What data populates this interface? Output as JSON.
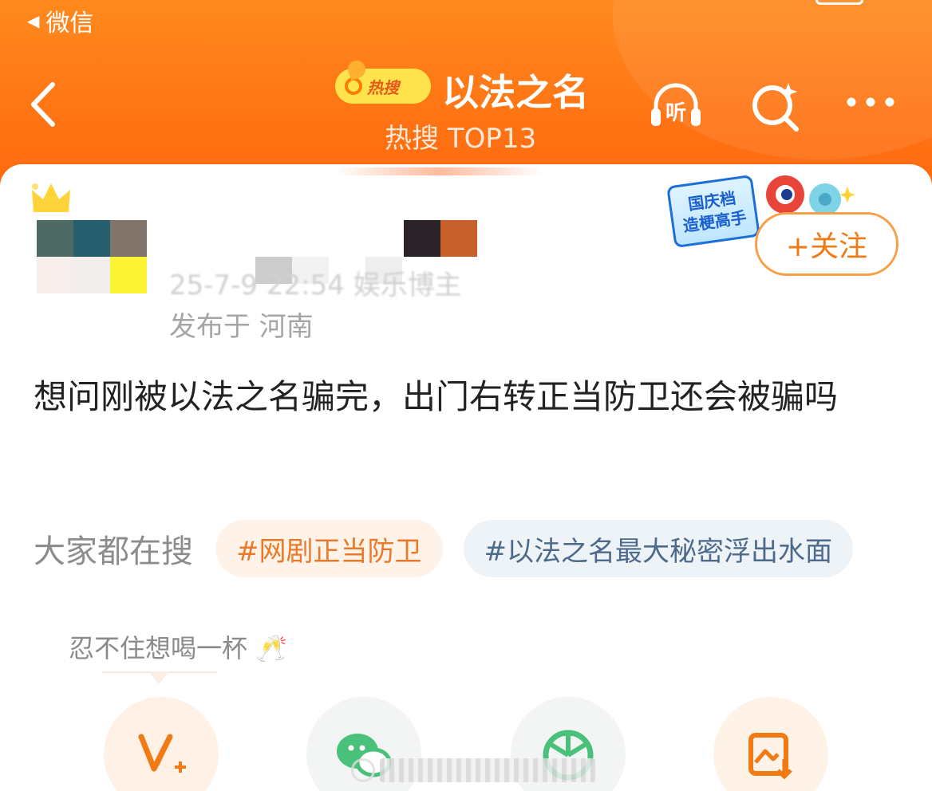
{
  "status_bar": {
    "back_app": "微信",
    "back_icon": "triangle-left-icon"
  },
  "header": {
    "back_icon": "chevron-left-icon",
    "hot_badge_label": "热搜",
    "title": "以法之名",
    "subtitle": "热搜 TOP13",
    "listen_icon": "headphones-listen-icon",
    "listen_label": "听",
    "search_icon": "search-sparkle-icon",
    "more_icon": "more-dots-icon"
  },
  "post": {
    "meta_blurred": "25-7-9 22:54  娱乐博主",
    "location": "发布于 河南",
    "promo_lines": [
      "国庆档",
      "造梗高手"
    ],
    "follow_label": "+关注",
    "text": "想问刚被以法之名骗完，出门右转正当防卫还会被骗吗"
  },
  "search_suggestions": {
    "label": "大家都在搜",
    "chips": [
      "#网剧正当防卫",
      "#以法之名最大秘密浮出水面"
    ]
  },
  "tooltip": {
    "text": "忍不住想喝一杯 🥂"
  },
  "share_bar": {
    "icons": [
      "weibo-vplus-icon",
      "wechat-icon",
      "moments-icon",
      "save-image-icon"
    ]
  },
  "colors": {
    "header_orange": "#ff7a1a",
    "accent_orange": "#f07a14",
    "chip_blue_text": "#4d6a8a"
  }
}
